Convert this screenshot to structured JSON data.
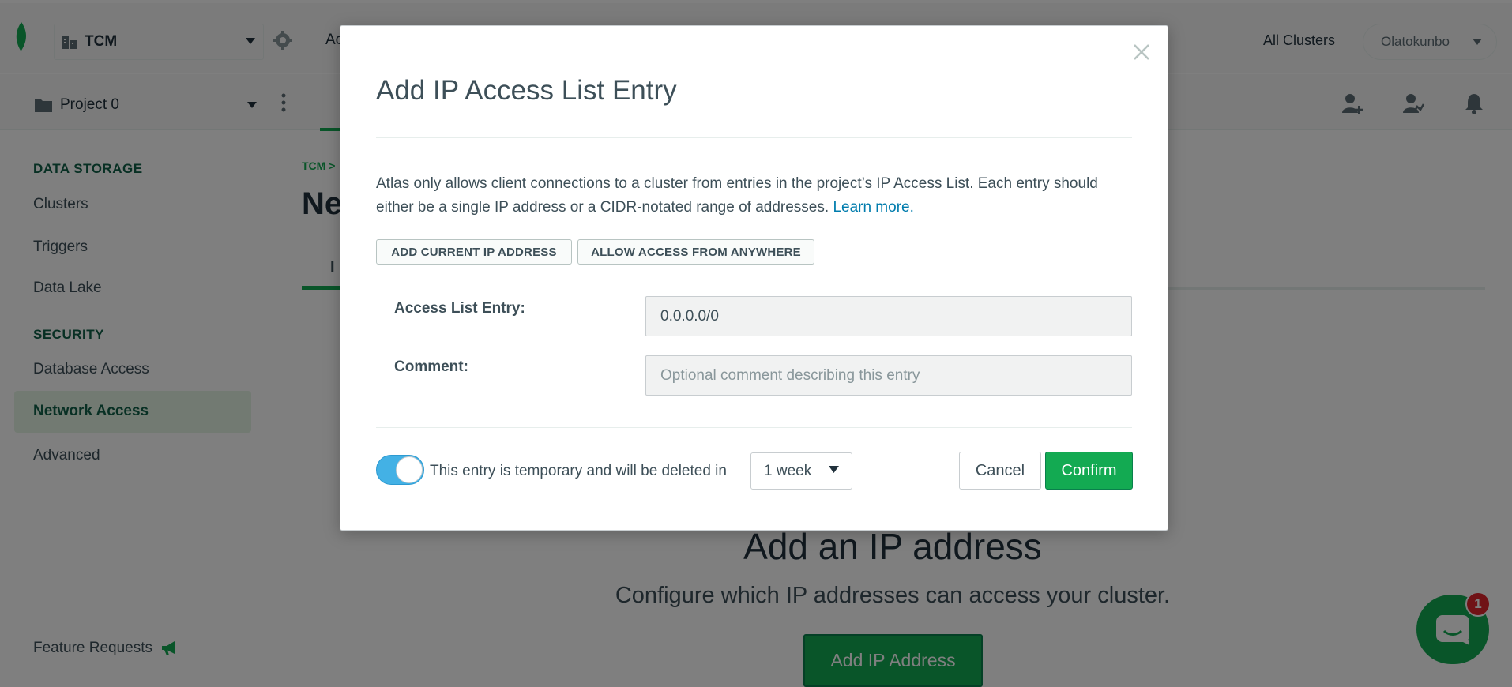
{
  "topbar": {
    "org_name": "TCM",
    "access_label": "Ac",
    "all_clusters": "All Clusters",
    "user_name": "Olatokunbo"
  },
  "projectbar": {
    "project_name": "Project 0"
  },
  "sidebar": {
    "data_storage_heading": "DATA STORAGE",
    "data_storage_items": [
      "Clusters",
      "Triggers",
      "Data Lake"
    ],
    "security_heading": "SECURITY",
    "security_items": [
      "Database Access",
      "Network Access",
      "Advanced"
    ],
    "active_item": "Network Access",
    "feature_requests": "Feature Requests"
  },
  "main": {
    "breadcrumb": "TCM >",
    "page_title_fragment": "Ne",
    "tab_fragment": "I",
    "empty_title": "Add an IP address",
    "empty_subtitle": "Configure which IP addresses can access your cluster.",
    "add_ip_button": "Add IP Address"
  },
  "chat": {
    "badge_count": "1"
  },
  "modal": {
    "title": "Add IP Access List Entry",
    "description": "Atlas only allows client connections to a cluster from entries in the project’s IP Access List. Each entry should either be a single IP address or a CIDR-notated range of addresses.",
    "learn_more": "Learn more.",
    "add_current_ip": "ADD CURRENT IP ADDRESS",
    "allow_anywhere": "ALLOW ACCESS FROM ANYWHERE",
    "access_list_label": "Access List Entry:",
    "access_list_value": "0.0.0.0/0",
    "comment_label": "Comment:",
    "comment_placeholder": "Optional comment describing this entry",
    "temporary_text": "This entry is temporary and will be deleted in",
    "temporary_enabled": true,
    "duration_value": "1 week",
    "cancel": "Cancel",
    "confirm": "Confirm"
  },
  "colors": {
    "brand_green": "#13aa52",
    "toggle_blue": "#43b1e5",
    "link_blue": "#007cad",
    "badge_red": "#e0252c"
  }
}
